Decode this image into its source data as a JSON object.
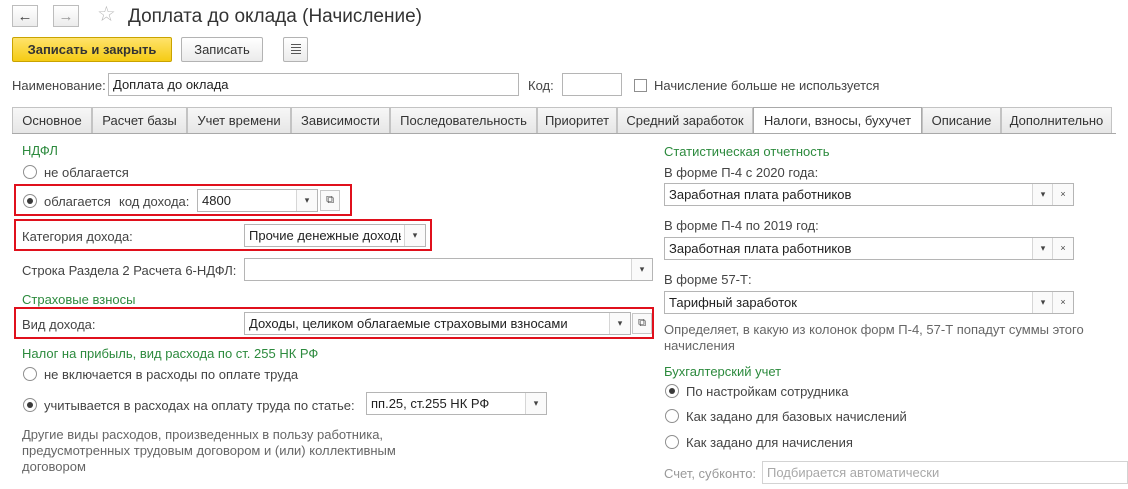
{
  "window": {
    "title": "Доплата до оклада (Начисление)",
    "back_icon": "←",
    "forward_icon": "→",
    "star_icon": "☆"
  },
  "toolbar": {
    "save_close_label": "Записать и закрыть",
    "save_label": "Записать"
  },
  "header": {
    "name_label": "Наименование:",
    "name_value": "Доплата до оклада",
    "code_label": "Код:",
    "code_value": "",
    "unused_label": "Начисление больше не используется"
  },
  "tabs": [
    {
      "label": "Основное"
    },
    {
      "label": "Расчет базы"
    },
    {
      "label": "Учет времени"
    },
    {
      "label": "Зависимости"
    },
    {
      "label": "Последовательность"
    },
    {
      "label": "Приоритет"
    },
    {
      "label": "Средний заработок"
    },
    {
      "label": "Налоги, взносы, бухучет"
    },
    {
      "label": "Описание"
    },
    {
      "label": "Дополнительно"
    }
  ],
  "ndfl": {
    "section_title": "НДФЛ",
    "not_taxed_label": "не облагается",
    "taxed_label": "облагается",
    "income_code_label": "код дохода:",
    "income_code_value": "4800",
    "income_category_label": "Категория дохода:",
    "income_category_value": "Прочие денежные доходы",
    "section2_label": "Строка Раздела 2 Расчета 6-НДФЛ:",
    "section2_value": ""
  },
  "insurance": {
    "section_title": "Страховые взносы",
    "income_type_label": "Вид дохода:",
    "income_type_value": "Доходы, целиком облагаемые страховыми взносами"
  },
  "profit_tax": {
    "section_title": "Налог на прибыль, вид расхода по ст. 255 НК РФ",
    "not_included_label": "не включается в расходы по оплате труда",
    "included_label": "учитывается в расходах на оплату труда по статье:",
    "article_value": "пп.25, ст.255 НК РФ",
    "note": "Другие виды расходов, произведенных в пользу работника, предусмотренных трудовым договором и (или) коллективным договором"
  },
  "statistics": {
    "section_title": "Статистическая отчетность",
    "p4_2020_label": "В форме П-4 с 2020 года:",
    "p4_2020_value": "Заработная плата работников",
    "p4_2019_label": "В форме П-4 по 2019 год:",
    "p4_2019_value": "Заработная плата работников",
    "f57t_label": "В форме 57-Т:",
    "f57t_value": "Тарифный заработок",
    "note": "Определяет, в какую из колонок форм П-4, 57-Т попадут суммы этого начисления"
  },
  "accounting": {
    "section_title": "Бухгалтерский учет",
    "option1": "По настройкам сотрудника",
    "option2": "Как задано для базовых начислений",
    "option3": "Как задано для начисления",
    "account_label": "Счет, субконто:",
    "account_placeholder": "Подбирается автоматически"
  },
  "glyphs": {
    "dropdown": "▾",
    "open": "⧉",
    "clear": "×"
  },
  "colors": {
    "section_green": "#2c8a3d",
    "highlight_red": "#e0101c",
    "primary_yellow": "#f5cc14"
  }
}
